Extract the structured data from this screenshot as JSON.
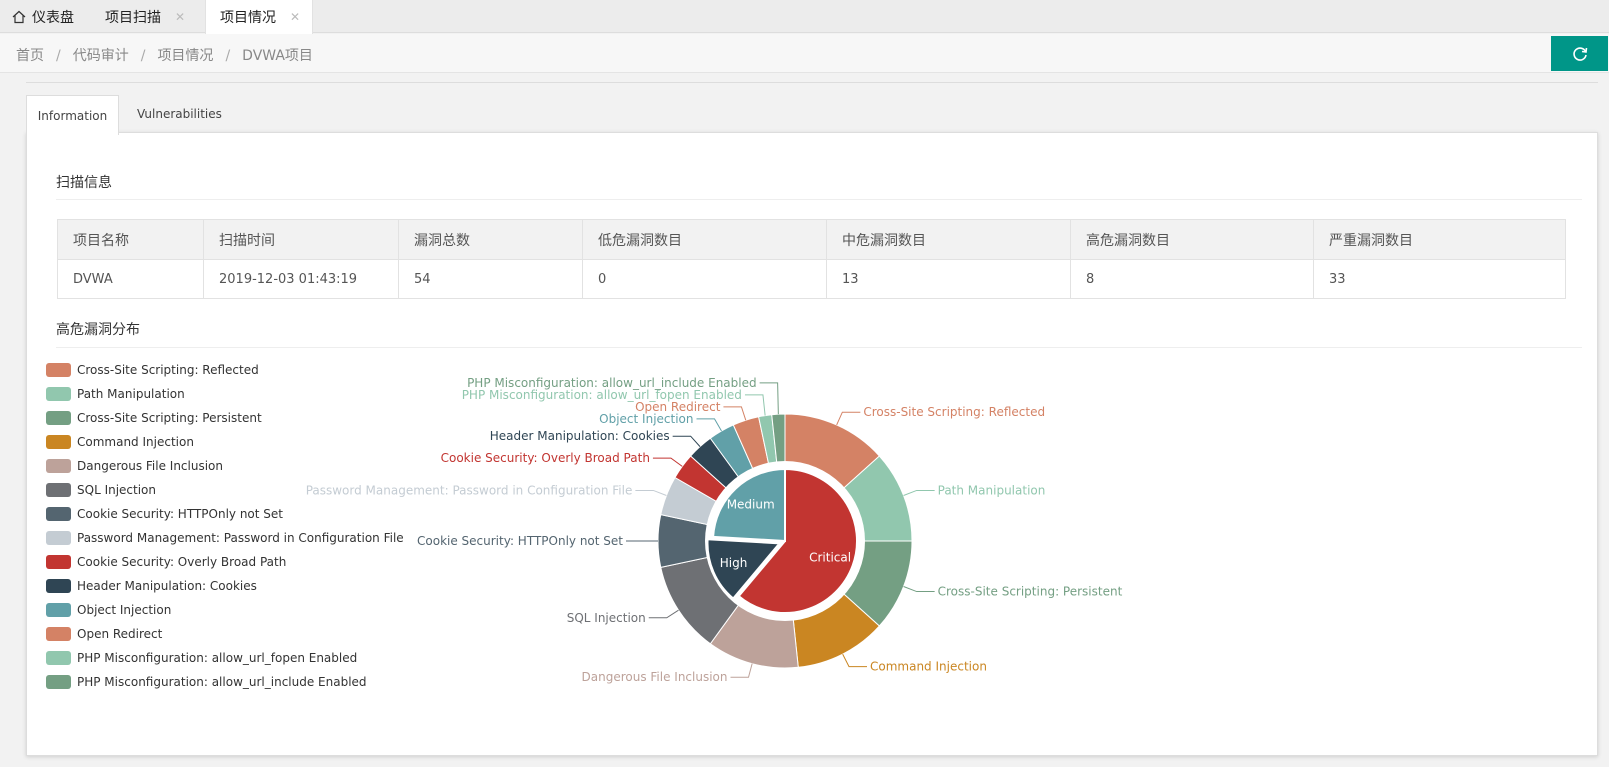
{
  "top_tabs": {
    "home_label": "仪表盘",
    "tab1_label": "项目扫描",
    "tab2_label": "项目情况",
    "close_glyph": "✕"
  },
  "breadcrumb": {
    "items": [
      "首页",
      "代码审计",
      "项目情况",
      "DVWA项目"
    ],
    "separator": "/"
  },
  "page_tabs": {
    "info_label": "Information",
    "vuln_label": "Vulnerabilities"
  },
  "scan_info": {
    "title": "扫描信息",
    "headers": [
      "项目名称",
      "扫描时间",
      "漏洞总数",
      "低危漏洞数目",
      "中危漏洞数目",
      "高危漏洞数目",
      "严重漏洞数目"
    ],
    "row": [
      "DVWA",
      "2019-12-03 01:43:19",
      "54",
      "0",
      "13",
      "8",
      "33"
    ]
  },
  "distribution": {
    "title": "高危漏洞分布"
  },
  "icons": {
    "home": "home-icon",
    "close": "close-icon",
    "refresh": "refresh-icon"
  },
  "colors": {
    "accent": "#009688"
  },
  "chart_data": {
    "type": "pie",
    "inner": {
      "categories": [
        "Critical",
        "High",
        "Medium"
      ],
      "values": [
        33,
        8,
        13
      ],
      "colors": [
        "#c23531",
        "#2f4554",
        "#61a0a8"
      ]
    },
    "outer": {
      "categories": [
        "Cross-Site Scripting: Reflected",
        "Path Manipulation",
        "Cross-Site Scripting: Persistent",
        "Command Injection",
        "Dangerous File Inclusion",
        "SQL Injection",
        "Cookie Security: HTTPOnly not Set",
        "Password Management: Password in Configuration File",
        "Cookie Security: Overly Broad Path",
        "Header Manipulation: Cookies",
        "Object Injection",
        "Open Redirect",
        "PHP Misconfiguration: allow_url_fopen Enabled",
        "PHP Misconfiguration: allow_url_include Enabled"
      ],
      "values": [
        8,
        7,
        7,
        7,
        7,
        7,
        4,
        3,
        2,
        2,
        2,
        2,
        1,
        1
      ],
      "colors": [
        "#d48265",
        "#91c7ae",
        "#749f83",
        "#ca8622",
        "#bda29a",
        "#6e7074",
        "#546570",
        "#c4ccd3",
        "#c23531",
        "#2f4554",
        "#61a0a8",
        "#d48265",
        "#91c7ae",
        "#749f83"
      ]
    }
  }
}
